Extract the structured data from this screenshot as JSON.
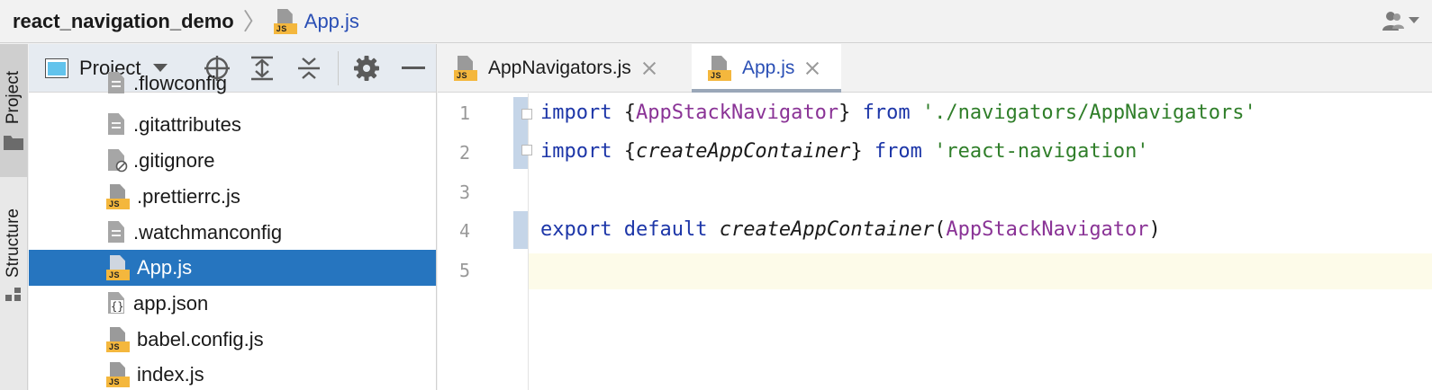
{
  "titlebar": {
    "project": "react_navigation_demo",
    "separator": "〉",
    "file": "App.js"
  },
  "icons": {
    "js_badge": "JS"
  },
  "left_strip": {
    "tabs": [
      {
        "label": "Project",
        "active": true
      },
      {
        "label": "Structure",
        "active": false
      }
    ]
  },
  "project_panel": {
    "title": "Project",
    "tools": [
      "locate-icon",
      "expand-all-icon",
      "collapse-all-icon",
      "gear-icon",
      "minimize-icon"
    ],
    "tree": [
      {
        "name": ".flowconfig",
        "icon": "text-file-icon",
        "selected": false
      },
      {
        "name": ".gitattributes",
        "icon": "text-file-icon",
        "selected": false
      },
      {
        "name": ".gitignore",
        "icon": "ignore-file-icon",
        "selected": false
      },
      {
        "name": ".prettierrc.js",
        "icon": "js-file-icon",
        "selected": false
      },
      {
        "name": ".watchmanconfig",
        "icon": "text-file-icon",
        "selected": false
      },
      {
        "name": "App.js",
        "icon": "js-file-icon",
        "selected": true
      },
      {
        "name": "app.json",
        "icon": "json-file-icon",
        "selected": false
      },
      {
        "name": "babel.config.js",
        "icon": "js-file-icon",
        "selected": false
      },
      {
        "name": "index.js",
        "icon": "js-file-icon",
        "selected": false
      }
    ]
  },
  "editor": {
    "tabs": [
      {
        "label": "AppNavigators.js",
        "active": false
      },
      {
        "label": "App.js",
        "active": true
      }
    ],
    "line_numbers": [
      "1",
      "2",
      "3",
      "4",
      "5"
    ],
    "lines": [
      [
        {
          "t": "import",
          "c": "kw"
        },
        {
          "t": " {",
          "c": ""
        },
        {
          "t": "AppStackNavigator",
          "c": "id"
        },
        {
          "t": "} ",
          "c": ""
        },
        {
          "t": "from",
          "c": "kw"
        },
        {
          "t": " ",
          "c": ""
        },
        {
          "t": "'./navigators/AppNavigators'",
          "c": "str"
        }
      ],
      [
        {
          "t": "import",
          "c": "kw"
        },
        {
          "t": " {",
          "c": ""
        },
        {
          "t": "createAppContainer",
          "c": "fn"
        },
        {
          "t": "} ",
          "c": ""
        },
        {
          "t": "from",
          "c": "kw"
        },
        {
          "t": " ",
          "c": ""
        },
        {
          "t": "'react-navigation'",
          "c": "str"
        }
      ],
      [],
      [
        {
          "t": "export",
          "c": "kw"
        },
        {
          "t": " ",
          "c": ""
        },
        {
          "t": "default",
          "c": "kw"
        },
        {
          "t": " ",
          "c": ""
        },
        {
          "t": "createAppContainer",
          "c": "fn"
        },
        {
          "t": "(",
          "c": ""
        },
        {
          "t": "AppStackNavigator",
          "c": "id"
        },
        {
          "t": ")",
          "c": ""
        }
      ],
      []
    ]
  },
  "colors": {
    "keyword": "#1d36a8",
    "identifier": "#8a3396",
    "string": "#2f7e29",
    "selection": "#2675bf",
    "active_file": "#2a4fb5",
    "js_badge": "#f4b73d"
  }
}
